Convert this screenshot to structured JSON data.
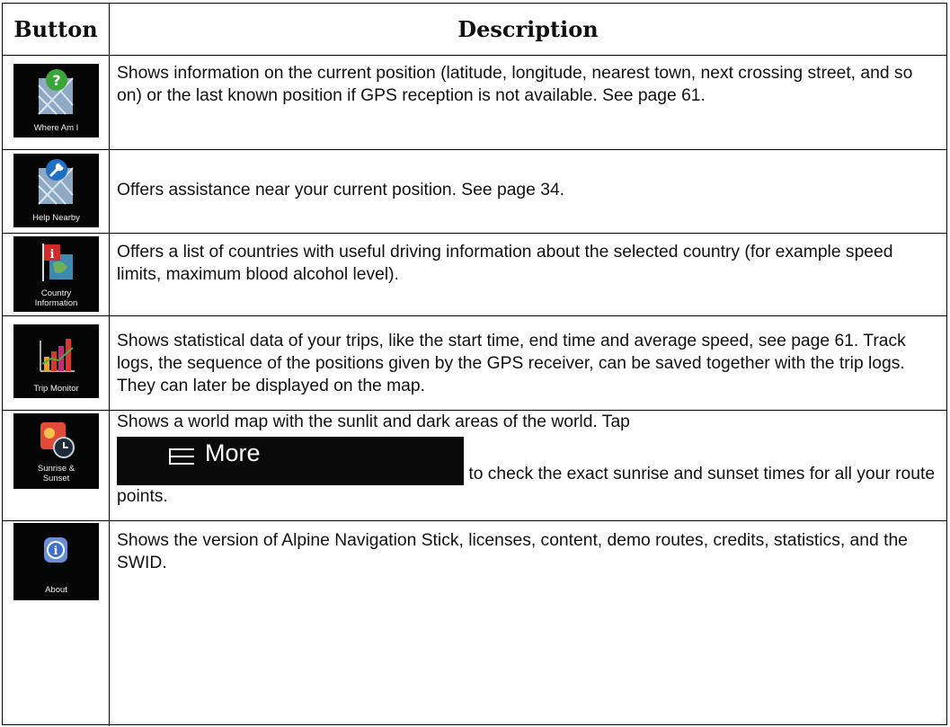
{
  "header": {
    "button_col": "Button",
    "description_col": "Description"
  },
  "rows": [
    {
      "icon": "where-am-i-icon",
      "label": "Where Am I",
      "description": "Shows information on the current position (latitude, longitude, nearest town, next crossing street, and so on) or the last known position if GPS reception is not available. See page 61."
    },
    {
      "icon": "help-nearby-icon",
      "label": "Help Nearby",
      "description": "Offers assistance near your current position. See page 34."
    },
    {
      "icon": "country-information-icon",
      "label_line1": "Country",
      "label_line2": "Information",
      "description": "Offers a list of countries with useful driving information about the selected country (for example speed limits, maximum blood alcohol level)."
    },
    {
      "icon": "trip-monitor-icon",
      "label": "Trip Monitor",
      "description": "Shows statistical data of your trips, like the start time, end time and average speed, see page 61. Track logs, the sequence of the positions given by the GPS receiver, can be saved together with the trip logs. They can later be displayed on the map."
    },
    {
      "icon": "sunrise-sunset-icon",
      "label_line1": "Sunrise &",
      "label_line2": "Sunset",
      "description_before": "Shows a world map with the sunlit and dark areas of the world. Tap",
      "more_button": {
        "icon": "menu-icon",
        "label": "More"
      },
      "description_after": " to check the exact sunrise and sunset times for all your route points."
    },
    {
      "icon": "about-icon",
      "label": "About",
      "description": "Shows the version of Alpine Navigation Stick, licenses, content, demo routes, credits, statistics, and the SWID."
    }
  ]
}
